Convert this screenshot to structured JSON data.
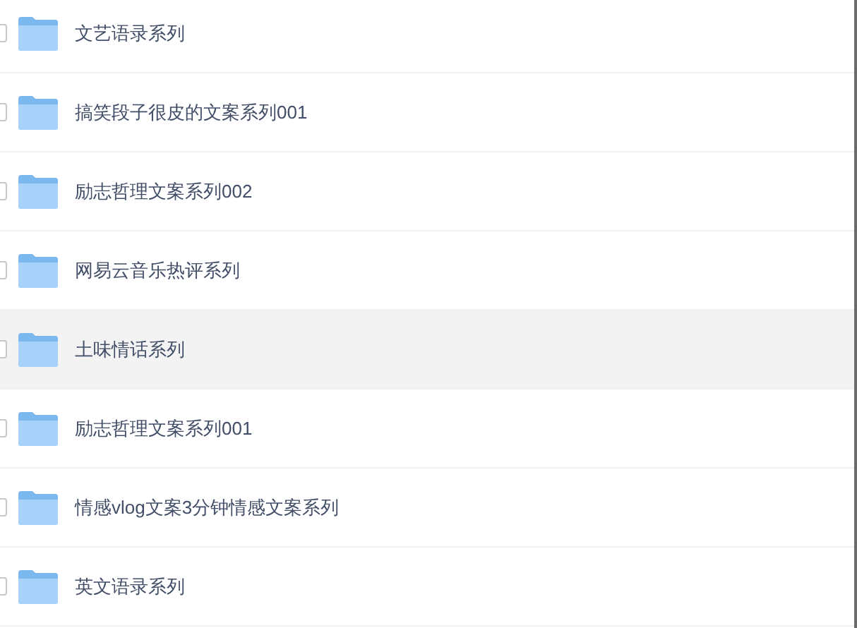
{
  "files": [
    {
      "name": "文艺语录系列",
      "checked": false,
      "highlighted": false
    },
    {
      "name": "搞笑段子很皮的文案系列001",
      "checked": false,
      "highlighted": false
    },
    {
      "name": "励志哲理文案系列002",
      "checked": false,
      "highlighted": false
    },
    {
      "name": "网易云音乐热评系列",
      "checked": false,
      "highlighted": false
    },
    {
      "name": "土味情话系列",
      "checked": false,
      "highlighted": true
    },
    {
      "name": "励志哲理文案系列001",
      "checked": false,
      "highlighted": false
    },
    {
      "name": "情感vlog文案3分钟情感文案系列",
      "checked": false,
      "highlighted": false
    },
    {
      "name": "英文语录系列",
      "checked": false,
      "highlighted": false
    }
  ]
}
